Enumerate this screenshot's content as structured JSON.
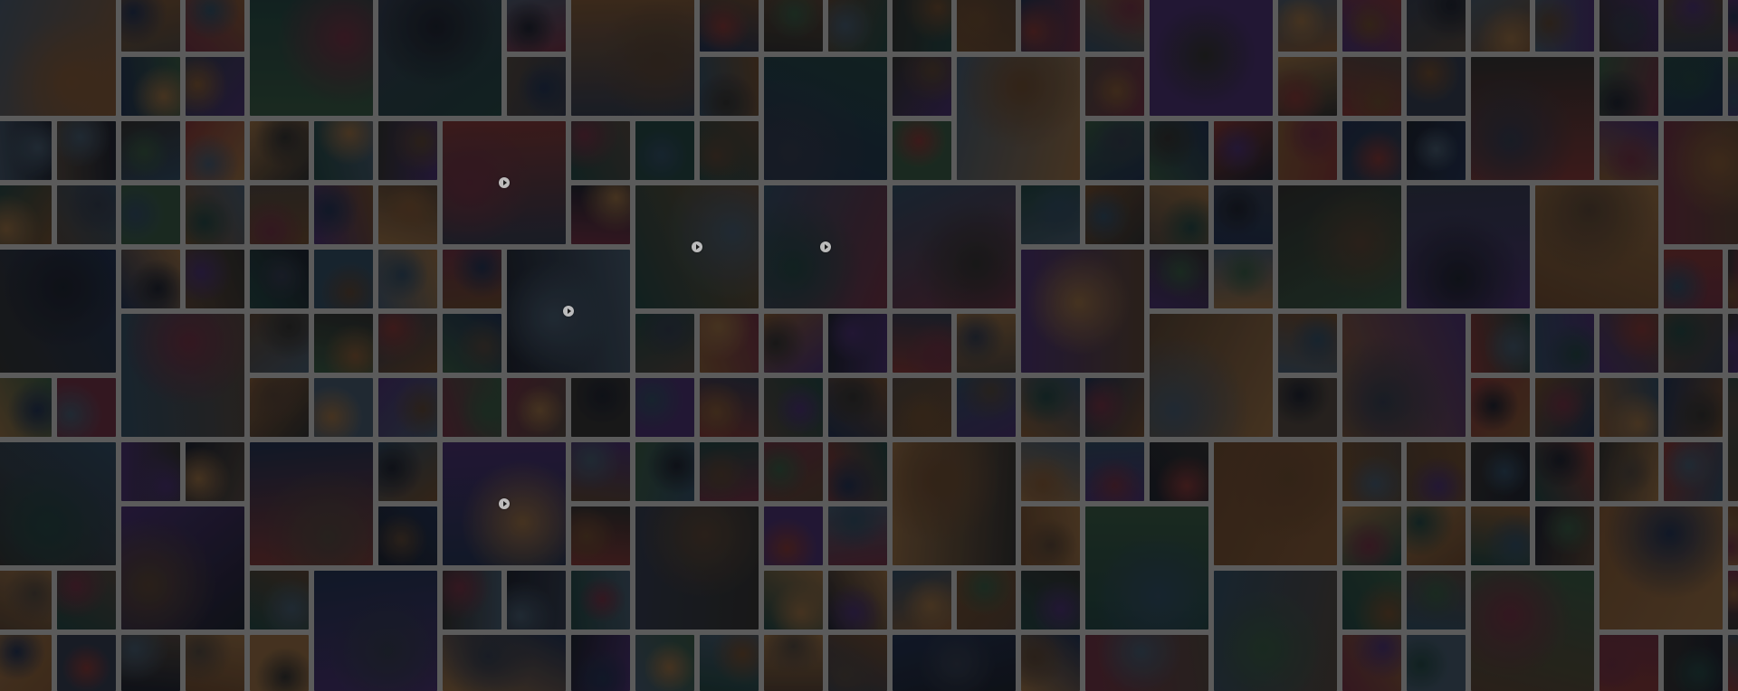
{
  "scene": {
    "description_type": "photo-mosaic-background",
    "palette": [
      "#1b1f2a",
      "#2c3342",
      "#4a3a2e",
      "#6b4a2f",
      "#2a3f52",
      "#5b2a3a",
      "#3d2a5c",
      "#1f3b3a",
      "#7a5a3a",
      "#2b2b2b",
      "#443c36",
      "#1e2b45",
      "#5a3f2a",
      "#3a4a5a",
      "#6a2f2f",
      "#2f4a3a"
    ]
  },
  "play_icon": "play-icon"
}
